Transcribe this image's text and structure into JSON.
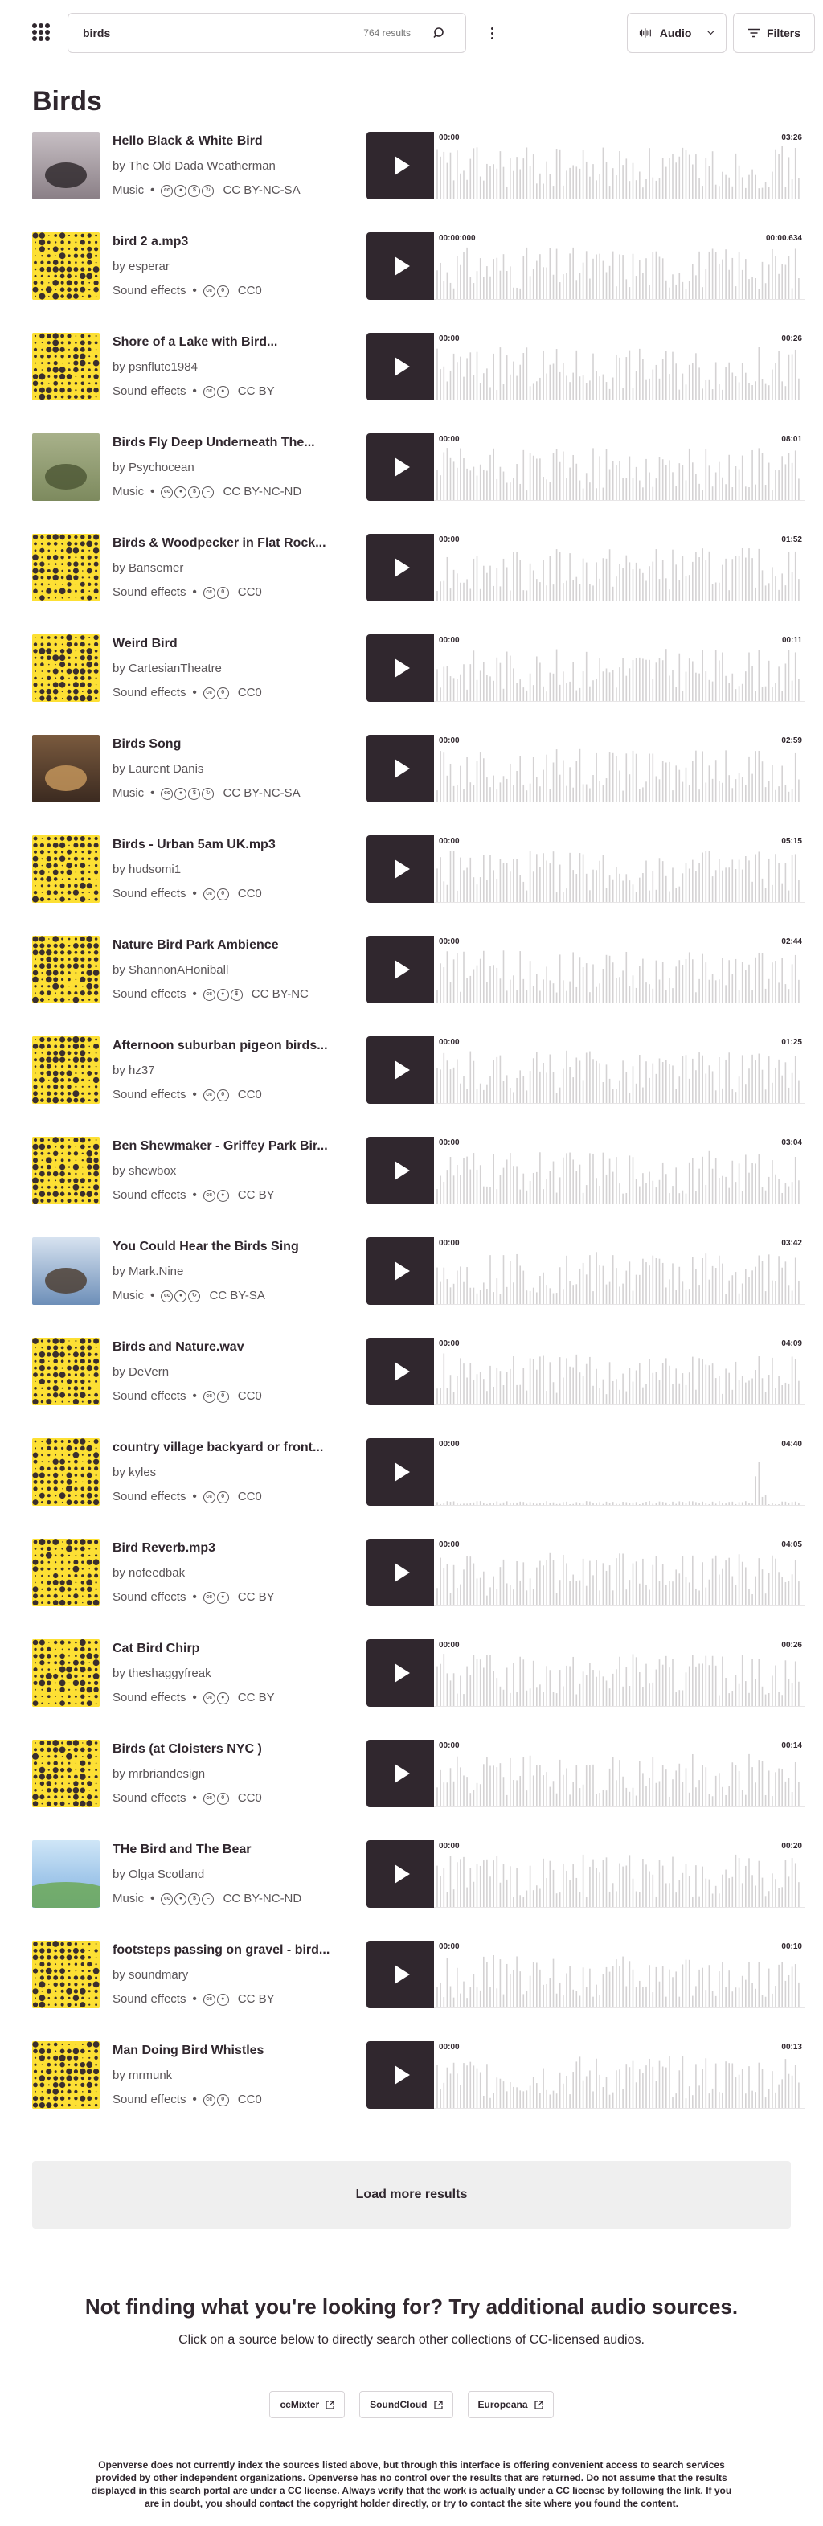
{
  "search": {
    "query": "birds",
    "result_count": "764 results"
  },
  "header": {
    "type_label": "Audio",
    "filters_label": "Filters"
  },
  "page_title": "Birds",
  "results": [
    {
      "title": "Hello Black & White Bird",
      "creator": "by The Old Dada Weatherman",
      "category": "Music",
      "license_icons": [
        "cc",
        "by",
        "nc",
        "sa"
      ],
      "license": "CC BY-NC-SA",
      "start": "00:00",
      "end": "03:26",
      "thumb": "photo1"
    },
    {
      "title": "bird 2 a.mp3",
      "creator": "by esperar",
      "category": "Sound effects",
      "license_icons": [
        "cc",
        "zero"
      ],
      "license": "CC0",
      "start": "00:00:000",
      "end": "00:00.634",
      "thumb": "yellow"
    },
    {
      "title": "Shore of a Lake with Bird...",
      "creator": "by psnflute1984",
      "category": "Sound effects",
      "license_icons": [
        "cc",
        "by"
      ],
      "license": "CC BY",
      "start": "00:00",
      "end": "00:26",
      "thumb": "yellow"
    },
    {
      "title": "Birds Fly Deep Underneath The...",
      "creator": "by Psychocean",
      "category": "Music",
      "license_icons": [
        "cc",
        "by",
        "nc",
        "nd"
      ],
      "license": "CC BY-NC-ND",
      "start": "00:00",
      "end": "08:01",
      "thumb": "photo2"
    },
    {
      "title": "Birds & Woodpecker in Flat Rock...",
      "creator": "by Bansemer",
      "category": "Sound effects",
      "license_icons": [
        "cc",
        "zero"
      ],
      "license": "CC0",
      "start": "00:00",
      "end": "01:52",
      "thumb": "yellow"
    },
    {
      "title": "Weird Bird",
      "creator": "by CartesianTheatre",
      "category": "Sound effects",
      "license_icons": [
        "cc",
        "zero"
      ],
      "license": "CC0",
      "start": "00:00",
      "end": "00:11",
      "thumb": "yellow"
    },
    {
      "title": "Birds Song",
      "creator": "by Laurent Danis",
      "category": "Music",
      "license_icons": [
        "cc",
        "by",
        "nc",
        "sa"
      ],
      "license": "CC BY-NC-SA",
      "start": "00:00",
      "end": "02:59",
      "thumb": "photo3"
    },
    {
      "title": "Birds - Urban 5am UK.mp3",
      "creator": "by hudsomi1",
      "category": "Sound effects",
      "license_icons": [
        "cc",
        "zero"
      ],
      "license": "CC0",
      "start": "00:00",
      "end": "05:15",
      "thumb": "yellow"
    },
    {
      "title": "Nature Bird Park Ambience",
      "creator": "by ShannonAHoniball",
      "category": "Sound effects",
      "license_icons": [
        "cc",
        "by",
        "nc"
      ],
      "license": "CC BY-NC",
      "start": "00:00",
      "end": "02:44",
      "thumb": "yellow"
    },
    {
      "title": "Afternoon suburban pigeon birds...",
      "creator": "by hz37",
      "category": "Sound effects",
      "license_icons": [
        "cc",
        "zero"
      ],
      "license": "CC0",
      "start": "00:00",
      "end": "01:25",
      "thumb": "yellow"
    },
    {
      "title": "Ben Shewmaker - Griffey Park Bir...",
      "creator": "by shewbox",
      "category": "Sound effects",
      "license_icons": [
        "cc",
        "by"
      ],
      "license": "CC BY",
      "start": "00:00",
      "end": "03:04",
      "thumb": "yellow"
    },
    {
      "title": "You Could Hear the Birds Sing",
      "creator": "by Mark.Nine",
      "category": "Music",
      "license_icons": [
        "cc",
        "by",
        "sa"
      ],
      "license": "CC BY-SA",
      "start": "00:00",
      "end": "03:42",
      "thumb": "photo4"
    },
    {
      "title": "Birds and Nature.wav",
      "creator": "by DeVern",
      "category": "Sound effects",
      "license_icons": [
        "cc",
        "zero"
      ],
      "license": "CC0",
      "start": "00:00",
      "end": "04:09",
      "thumb": "yellow"
    },
    {
      "title": "country village backyard or front...",
      "creator": "by kyles",
      "category": "Sound effects",
      "license_icons": [
        "cc",
        "zero"
      ],
      "license": "CC0",
      "start": "00:00",
      "end": "04:40",
      "thumb": "yellow"
    },
    {
      "title": "Bird Reverb.mp3",
      "creator": "by nofeedbak",
      "category": "Sound effects",
      "license_icons": [
        "cc",
        "by"
      ],
      "license": "CC BY",
      "start": "00:00",
      "end": "04:05",
      "thumb": "yellow"
    },
    {
      "title": "Cat Bird Chirp",
      "creator": "by theshaggyfreak",
      "category": "Sound effects",
      "license_icons": [
        "cc",
        "by"
      ],
      "license": "CC BY",
      "start": "00:00",
      "end": "00:26",
      "thumb": "yellow"
    },
    {
      "title": "Birds (at Cloisters NYC )",
      "creator": "by mrbriandesign",
      "category": "Sound effects",
      "license_icons": [
        "cc",
        "zero"
      ],
      "license": "CC0",
      "start": "00:00",
      "end": "00:14",
      "thumb": "yellow"
    },
    {
      "title": "THe Bird and The Bear",
      "creator": "by Olga Scotland",
      "category": "Music",
      "license_icons": [
        "cc",
        "by",
        "nc",
        "nd"
      ],
      "license": "CC BY-NC-ND",
      "start": "00:00",
      "end": "00:20",
      "thumb": "photo5"
    },
    {
      "title": "footsteps passing on gravel - bird...",
      "creator": "by soundmary",
      "category": "Sound effects",
      "license_icons": [
        "cc",
        "by"
      ],
      "license": "CC BY",
      "start": "00:00",
      "end": "00:10",
      "thumb": "yellow"
    },
    {
      "title": "Man Doing Bird Whistles",
      "creator": "by mrmunk",
      "category": "Sound effects",
      "license_icons": [
        "cc",
        "zero"
      ],
      "license": "CC0",
      "start": "00:00",
      "end": "00:13",
      "thumb": "yellow"
    }
  ],
  "load_more": "Load more results",
  "not_finding": {
    "title": "Not finding what you're looking for? Try additional audio sources.",
    "subtitle": "Click on a source below to directly search other collections of CC-licensed audios.",
    "sources": [
      "ccMixter",
      "SoundCloud",
      "Europeana"
    ]
  },
  "disclaimer": "Openverse does not currently index the sources listed above, but through this interface is offering convenient access to search services provided by other independent organizations. Openverse has no control over the results that are returned. Do not assume that the results displayed in this search portal are under a CC license. Always verify that the work is actually under a CC license by following the link. If you are in doubt, you should contact the copyright holder directly, or try to contact the site where you found the content."
}
